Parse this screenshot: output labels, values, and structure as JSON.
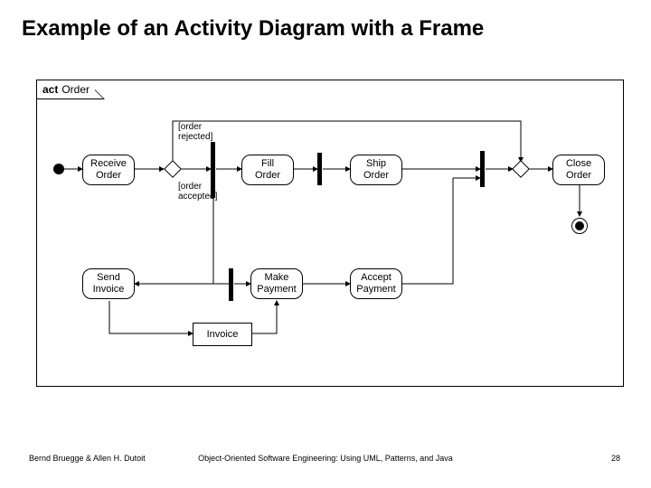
{
  "title": "Example of an Activity Diagram with a Frame",
  "frame": {
    "keyword": "act",
    "name": "Order"
  },
  "activities": {
    "receive": "Receive\nOrder",
    "fill": "Fill\nOrder",
    "ship": "Ship\nOrder",
    "close": "Close\nOrder",
    "send_invoice": "Send\nInvoice",
    "make_payment": "Make\nPayment",
    "accept_payment": "Accept\nPayment"
  },
  "object_nodes": {
    "invoice": "Invoice"
  },
  "guards": {
    "rejected": "[order\nrejected]",
    "accepted": "[order\naccepted]"
  },
  "footer": {
    "left": "Bernd Bruegge & Allen H. Dutoit",
    "center": "Object-Oriented Software Engineering: Using UML, Patterns, and Java",
    "right": "28"
  }
}
